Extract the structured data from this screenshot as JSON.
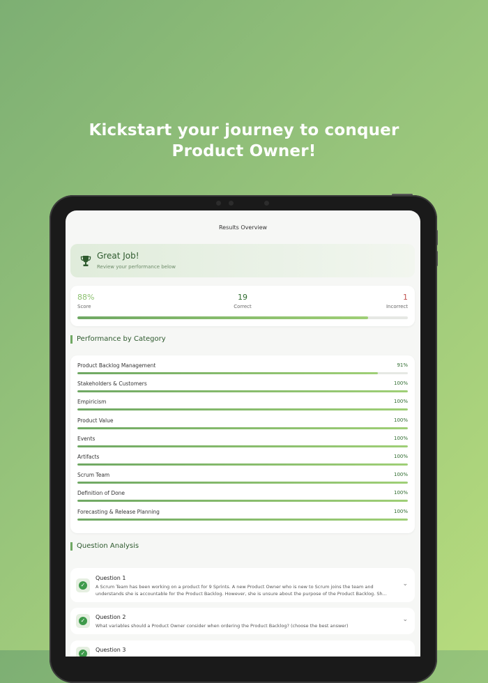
{
  "headline": {
    "line1": "Kickstart your journey to conquer",
    "line2": "Product Owner!"
  },
  "screen": {
    "title": "Results Overview"
  },
  "hero": {
    "title": "Great Job!",
    "subtitle": "Review your performance below",
    "icon": "trophy-icon"
  },
  "stats": {
    "score": {
      "value": "88%",
      "label": "Score"
    },
    "correct": {
      "value": "19",
      "label": "Correct"
    },
    "incorrect": {
      "value": "1",
      "label": "Incorrect"
    },
    "progress_fraction": 0.88
  },
  "performance": {
    "title": "Performance by Category",
    "categories": [
      {
        "name": "Product Backlog Management",
        "pct": "91%",
        "fraction": 0.91
      },
      {
        "name": "Stakeholders & Customers",
        "pct": "100%",
        "fraction": 1.0
      },
      {
        "name": "Empiricism",
        "pct": "100%",
        "fraction": 1.0
      },
      {
        "name": "Product Value",
        "pct": "100%",
        "fraction": 1.0
      },
      {
        "name": "Events",
        "pct": "100%",
        "fraction": 1.0
      },
      {
        "name": "Artifacts",
        "pct": "100%",
        "fraction": 1.0
      },
      {
        "name": "Scrum Team",
        "pct": "100%",
        "fraction": 1.0
      },
      {
        "name": "Definition of Done",
        "pct": "100%",
        "fraction": 1.0
      },
      {
        "name": "Forecasting & Release Planning",
        "pct": "100%",
        "fraction": 1.0
      }
    ]
  },
  "analysis": {
    "title": "Question Analysis",
    "questions": [
      {
        "title": "Question 1",
        "text": "A Scrum Team has been working on a product for 9 Sprints. A new Product Owner who is new to Scrum joins the team and understands she is accountable for the Product Backlog. However, she is unsure about the purpose of the Product Backlog. Sh..."
      },
      {
        "title": "Question 2",
        "text": "What variables should a Product Owner consider when ordering the Product Backlog? (choose the best answer)"
      },
      {
        "title": "Question 3",
        "text": ""
      }
    ]
  },
  "colors": {
    "accent": "#6fa863",
    "score": "#8cc06f",
    "correct": "#2e6b2e",
    "incorrect": "#c0504d",
    "dark_green": "#2e5a2e"
  }
}
